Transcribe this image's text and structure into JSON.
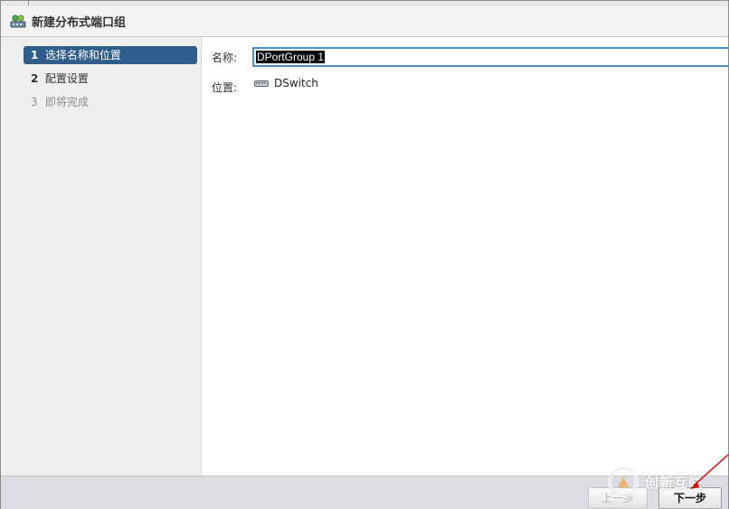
{
  "window": {
    "title": "新建分布式端口组"
  },
  "steps": [
    {
      "num": "1",
      "label": "选择名称和位置",
      "state": "active"
    },
    {
      "num": "2",
      "label": "配置设置",
      "state": "normal"
    },
    {
      "num": "3",
      "label": "即将完成",
      "state": "disabled"
    }
  ],
  "form": {
    "name_label": "名称:",
    "name_value": "DPortGroup 1",
    "location_label": "位置:",
    "location_value": "DSwitch"
  },
  "footer": {
    "prev_label": "上一步",
    "next_label": "下一步"
  },
  "watermark": {
    "text": "创新互联"
  },
  "colors": {
    "active_step": "#2f5d8c",
    "input_focus": "#4f8fc9",
    "footer_bg": "#dcdde3"
  }
}
